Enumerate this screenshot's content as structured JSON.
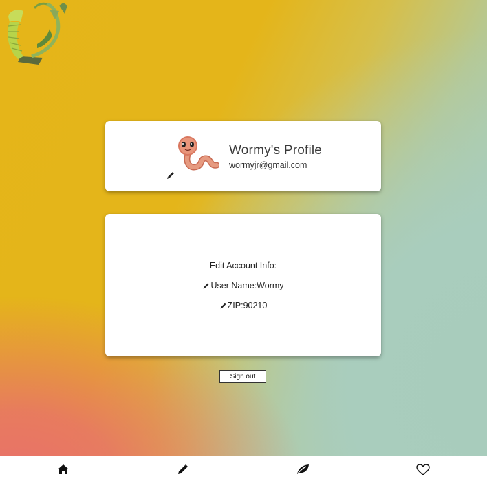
{
  "profile": {
    "name": "Wormy's Profile",
    "email": "wormyjr@gmail.com"
  },
  "edit_account": {
    "title": "Edit Account Info:",
    "username_row": "User Name:Wormy",
    "zip_row": "ZIP:90210"
  },
  "actions": {
    "sign_out_label": "Sign out"
  },
  "nav": {
    "items": [
      {
        "icon": "home-icon"
      },
      {
        "icon": "pencil-icon"
      },
      {
        "icon": "leaf-icon"
      },
      {
        "icon": "heart-icon"
      }
    ]
  },
  "colors": {
    "yellow": "#e5b519",
    "coral": "#e8716a",
    "mint": "#a8ccbc",
    "card": "#ffffff"
  }
}
